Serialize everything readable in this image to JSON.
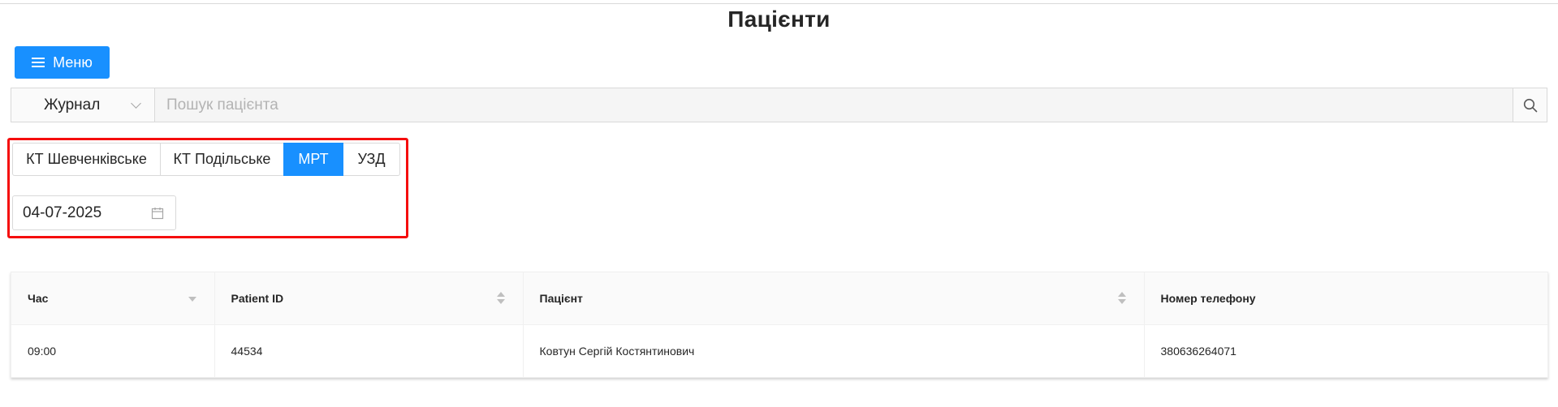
{
  "page": {
    "title": "Пацієнти"
  },
  "menu_button": {
    "label": "Меню",
    "icon": "menu-icon"
  },
  "search": {
    "select_value": "Журнал",
    "placeholder": "Пошук пацієнта",
    "icon": "search-icon"
  },
  "segments": [
    {
      "label": "КТ Шевченківське",
      "active": false
    },
    {
      "label": "КТ Подільське",
      "active": false
    },
    {
      "label": "МРТ",
      "active": true
    },
    {
      "label": "УЗД",
      "active": false
    }
  ],
  "date_picker": {
    "value": "04-07-2025",
    "icon": "calendar-icon"
  },
  "table": {
    "columns": [
      "Час",
      "Patient ID",
      "Пацієнт",
      "Номер телефону"
    ],
    "rows": [
      [
        "09:00",
        "44534",
        "Ковтун Сергій Костянтинович",
        "380636264071"
      ]
    ]
  },
  "colors": {
    "accent": "#1890ff",
    "highlight": "#f50d0d"
  }
}
